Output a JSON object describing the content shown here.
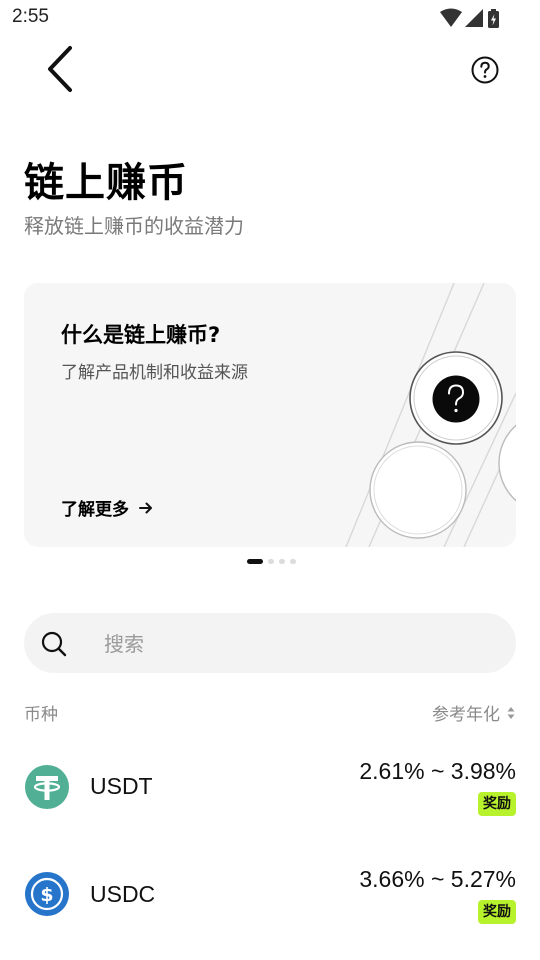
{
  "status_bar": {
    "time": "2:55",
    "icons": [
      "wifi-icon",
      "signal-icon",
      "battery-charging-icon"
    ]
  },
  "header": {
    "back_icon": "chevron-left-icon",
    "help_icon": "question-circle-icon"
  },
  "title": "链上赚币",
  "subtitle": "释放链上赚币的收益潜力",
  "banner": {
    "title": "什么是链上赚币?",
    "description": "了解产品机制和收益来源",
    "link_label": "了解更多",
    "link_icon": "arrow-right-icon",
    "illustration_icon": "question-mark-icon",
    "pages": 4,
    "active_page": 1
  },
  "search": {
    "placeholder": "搜索",
    "value": ""
  },
  "list_header": {
    "coin_label": "币种",
    "apy_label": "参考年化"
  },
  "coins": [
    {
      "name": "USDT",
      "apy": "2.61% ~ 3.98%",
      "badge": "奖励",
      "logo_icon": "tether-logo-icon",
      "logo_color": "#50AF95"
    },
    {
      "name": "USDC",
      "apy": "3.66% ~ 5.27%",
      "badge": "奖励",
      "logo_icon": "usdc-logo-icon",
      "logo_color": "#2775CA"
    }
  ],
  "colors": {
    "badge_bg": "#B8F22D",
    "muted_text": "#8A8A8A"
  }
}
